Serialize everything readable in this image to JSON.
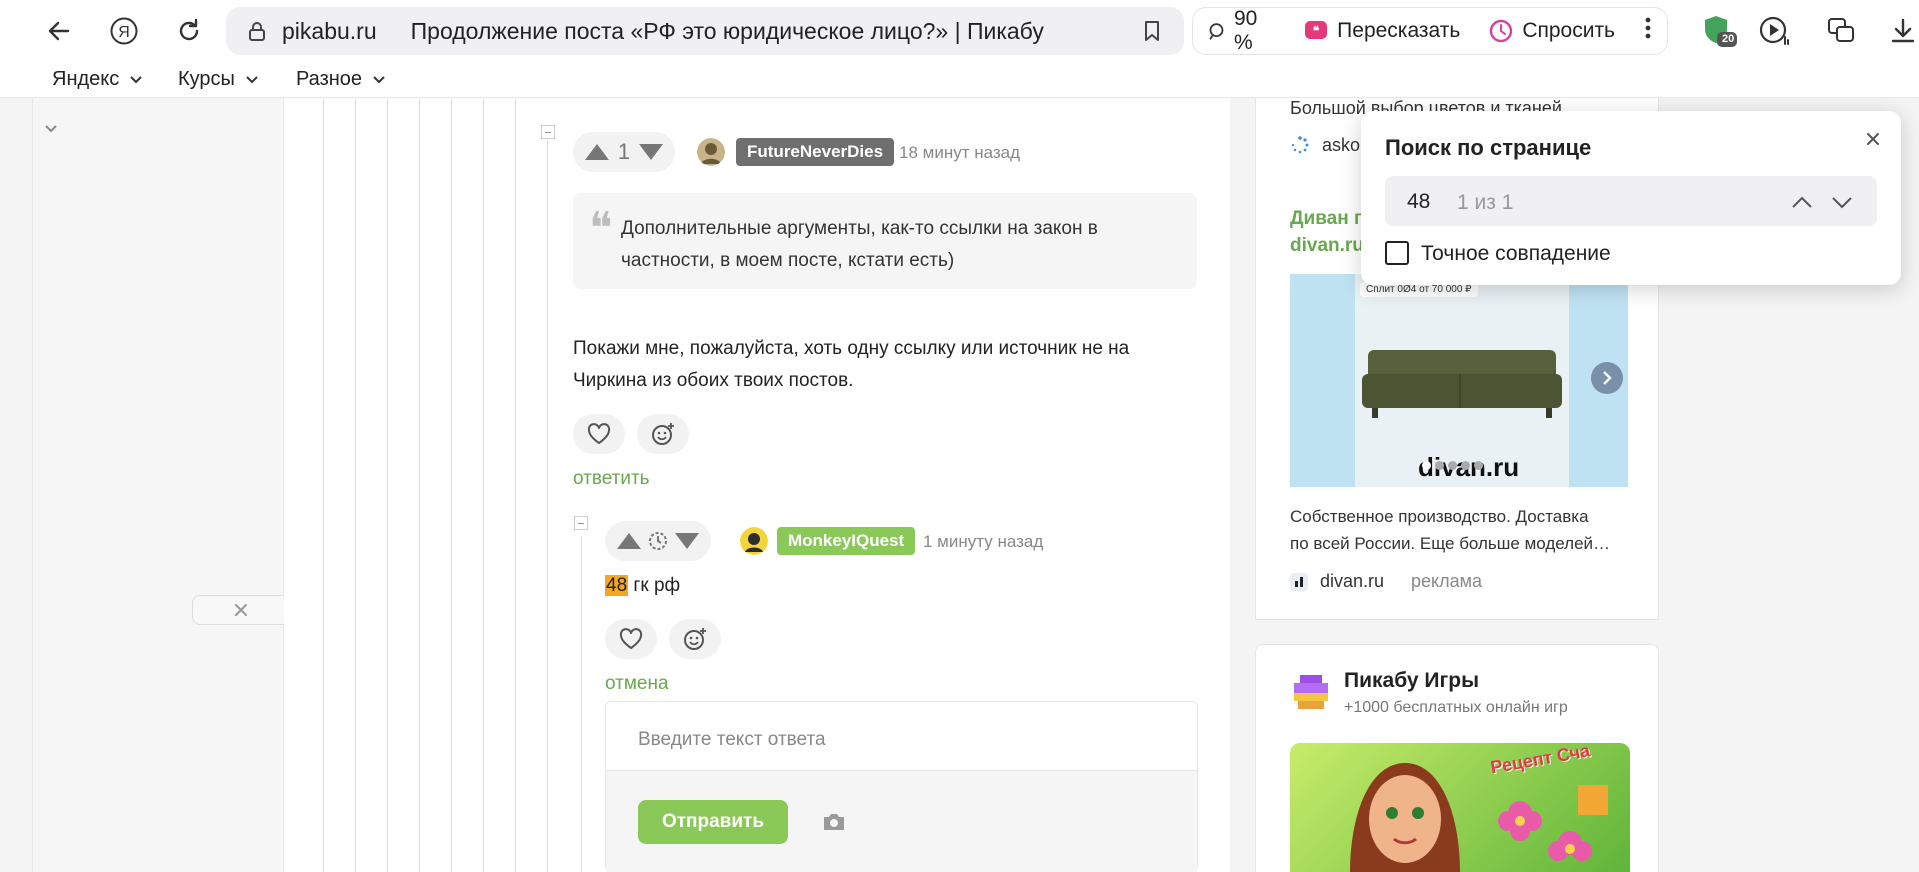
{
  "browser": {
    "host": "pikabu.ru",
    "tab_title": "Продолжение поста «РФ это юридическое лицо?» | Пикабу",
    "zoom": "90 %",
    "retell_label": "Пересказать",
    "ask_label": "Спросить",
    "shield_count": "20",
    "bookmarks": [
      "Яндекс",
      "Курсы",
      "Разное"
    ]
  },
  "thread": {
    "comment1": {
      "rating": "1",
      "user": "FutureNeverDies",
      "time": "18 минут назад",
      "quote_line1": "Дополнительные аргументы, как-то ссылки на закон в",
      "quote_line2": "частности, в моем посте, кстати есть)",
      "text_line1": "Покажи мне, пожалуйста, хоть одну ссылку или источник не на",
      "text_line2": "Чиркина из обоих твоих постов.",
      "reply_label": "ответить"
    },
    "comment2": {
      "user": "MonkeyIQuest",
      "time": "1 минуту назад",
      "highlight": "48",
      "text_rest": " гк рф",
      "cancel_label": "отмена",
      "reply_placeholder": "Введите текст ответа",
      "send_label": "Отправить"
    }
  },
  "ad": {
    "top_text": "Большой выбор цветов и тканей",
    "top_source": "askon",
    "title_line1": "Диван п",
    "title_line2": "divan.ru",
    "promo_badge": "Сплит 0Ø4 от 70 000 ₽",
    "image_logo": "divan.ru",
    "desc_line1": "Собственное производство. Доставка",
    "desc_line2": "по всей России. Еще больше моделей…",
    "source": "divan.ru",
    "ad_label": "реклама"
  },
  "games": {
    "title": "Пикабу Игры",
    "subtitle": "+1000 бесплатных онлайн игр",
    "banner_text": "Рецепт Сча"
  },
  "find": {
    "title": "Поиск по странице",
    "query": "48",
    "count": "1 из 1",
    "exact_label": "Точное совпадение"
  },
  "colors": {
    "accent_green": "#8ac858",
    "user1_badge": "#6f6f6f",
    "user2_badge": "#8ac858",
    "highlight": "#f5a623",
    "link_green": "#6aa84f"
  }
}
